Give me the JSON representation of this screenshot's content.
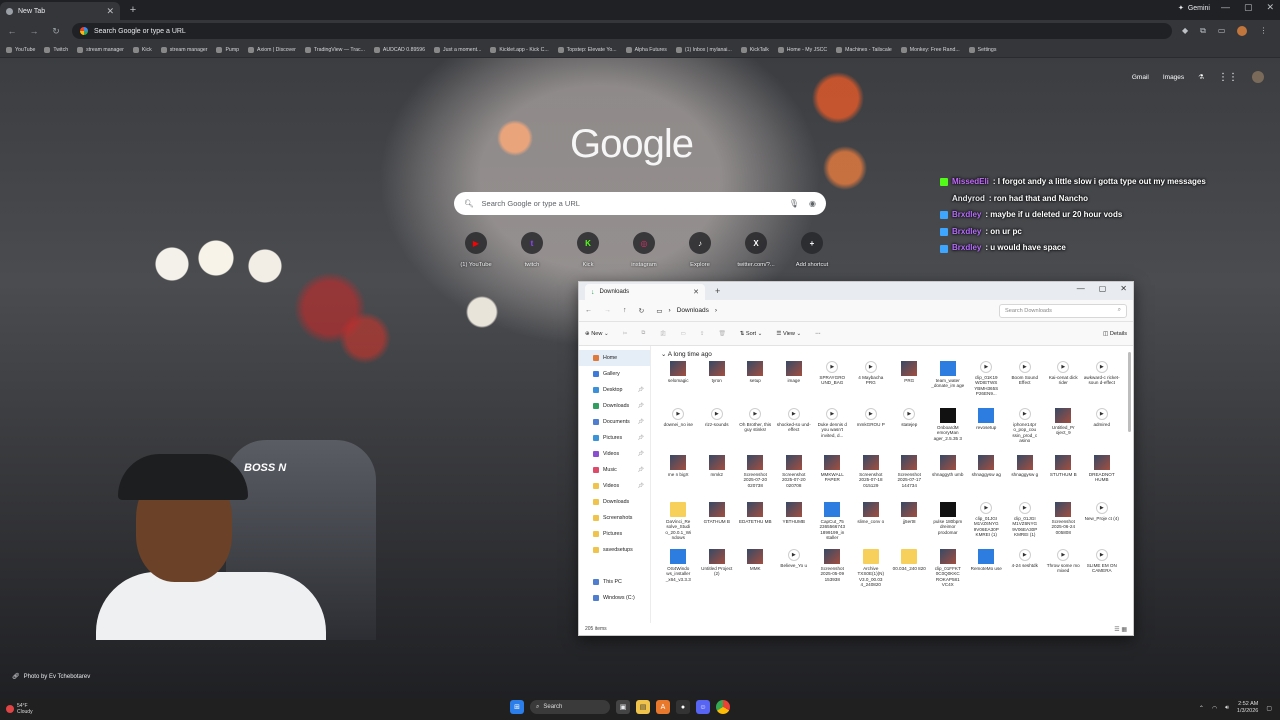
{
  "browser": {
    "tab_title": "New Tab",
    "omnibox_placeholder": "Search Google or type a URL",
    "gemini_label": "Gemini",
    "bookmarks": [
      "YouTube",
      "Twitch",
      "stream manager",
      "Kick",
      "stream manager",
      "Pump",
      "Axiom | Discover",
      "TradingView — Trac...",
      "AUDCAD 0.89596",
      "Just a moment...",
      "Kicklet.app - Kick C...",
      "Topstep: Elevate Yo...",
      "Alpha Futures",
      "(1) Inbox | mylanai...",
      "KickTalk",
      "Home - My JSCC",
      "Machines - Tailscale",
      "Monkey: Free Rand...",
      "Settings"
    ]
  },
  "newtab": {
    "logo": "Google",
    "search_placeholder": "Search Google or type a URL",
    "top_links": {
      "gmail": "Gmail",
      "images": "Images"
    },
    "shortcuts": [
      {
        "label": "(1) YouTube",
        "glyph": "▶",
        "color": "#ff0000"
      },
      {
        "label": "twitch",
        "glyph": "t",
        "color": "#9146ff"
      },
      {
        "label": "Kick",
        "glyph": "K",
        "color": "#53fc18"
      },
      {
        "label": "instagram",
        "glyph": "◎",
        "color": "#e1306c"
      },
      {
        "label": "Explore",
        "glyph": "♪",
        "color": "#ffffff"
      },
      {
        "label": "twitter.com/?...",
        "glyph": "X",
        "color": "#ffffff"
      },
      {
        "label": "Add shortcut",
        "glyph": "+",
        "color": "#ffffff"
      }
    ],
    "photo_credit": "Photo by Ev Tchebotarev"
  },
  "chat": [
    {
      "user": "MissedEli",
      "color": "#c56bff",
      "badge": "g",
      "message": ": I forgot andy a little slow i gotta type out my messages"
    },
    {
      "user": "Andyrod",
      "color": "#e8eaed",
      "badge": "",
      "message": ": ron had that and Nancho"
    },
    {
      "user": "Brxdley",
      "color": "#b76cff",
      "badge": "b",
      "message": ": maybe if u deleted ur 20 hour vods"
    },
    {
      "user": "Brxdley",
      "color": "#b76cff",
      "badge": "b",
      "message": ": on ur pc"
    },
    {
      "user": "Brxdley",
      "color": "#b76cff",
      "badge": "b",
      "message": ": u would have space"
    }
  ],
  "webcam": {
    "chair_text": "BOSS N"
  },
  "explorer": {
    "tab_title": "Downloads",
    "path": "Downloads",
    "search_placeholder": "Search Downloads",
    "commands": {
      "new": "New",
      "sort": "Sort",
      "view": "View",
      "details": "Details"
    },
    "sidebar": [
      {
        "label": "Home",
        "color": "#e07a3a",
        "selected": true,
        "pin": false
      },
      {
        "label": "Gallery",
        "color": "#3c7bd9",
        "selected": false,
        "pin": false
      },
      {
        "label": "Desktop",
        "color": "#3c8fd9",
        "selected": false,
        "pin": true
      },
      {
        "label": "Downloads",
        "color": "#2f9e5f",
        "selected": false,
        "pin": true
      },
      {
        "label": "Documents",
        "color": "#4f7ed0",
        "selected": false,
        "pin": true
      },
      {
        "label": "Pictures",
        "color": "#3b93d8",
        "selected": false,
        "pin": true
      },
      {
        "label": "Videos",
        "color": "#8a4fd0",
        "selected": false,
        "pin": true
      },
      {
        "label": "Music",
        "color": "#e04a6a",
        "selected": false,
        "pin": true
      },
      {
        "label": "Videos",
        "color": "#f0c44c",
        "selected": false,
        "pin": true
      },
      {
        "label": "Downloads",
        "color": "#f0c44c",
        "selected": false,
        "pin": false
      },
      {
        "label": "Screenshots",
        "color": "#f0c44c",
        "selected": false,
        "pin": false
      },
      {
        "label": "Pictures",
        "color": "#f0c44c",
        "selected": false,
        "pin": false
      },
      {
        "label": "savedsetups",
        "color": "#f0c44c",
        "selected": false,
        "pin": false
      },
      {
        "label": "",
        "color": "transparent",
        "selected": false,
        "pin": false
      },
      {
        "label": "This PC",
        "color": "#4f7ed0",
        "selected": false,
        "pin": false
      },
      {
        "label": "Windows (C:)",
        "color": "#4f7ed0",
        "selected": false,
        "pin": false
      }
    ],
    "group_label": "A long time ago",
    "files": [
      {
        "name": "selomagic",
        "kind": "img"
      },
      {
        "name": "tyron",
        "kind": "img"
      },
      {
        "name": "setup",
        "kind": "img"
      },
      {
        "name": "image",
        "kind": "img"
      },
      {
        "name": "SPRAYGRO UND_BAG",
        "kind": "vid"
      },
      {
        "name": "4 Maybacha PRG",
        "kind": "vid"
      },
      {
        "name": "PRG",
        "kind": "img"
      },
      {
        "name": "team_water _donate_im age",
        "kind": "app"
      },
      {
        "name": "clip_01K19 WDIETWS YBMH365S P26EN9...",
        "kind": "vid"
      },
      {
        "name": "Boom Sound Effect",
        "kind": "vid"
      },
      {
        "name": "Kai-cenat dick rider",
        "kind": "vid"
      },
      {
        "name": "awkward-c ricket-soun d-effect",
        "kind": "vid"
      },
      {
        "name": "downei_no ise",
        "kind": "vid"
      },
      {
        "name": "rizz-sounds",
        "kind": "vid"
      },
      {
        "name": "Oh Brother, this guy stinks!",
        "kind": "vid"
      },
      {
        "name": "shocked-so und-effect",
        "kind": "vid"
      },
      {
        "name": "Duke dennis d you wasn't invited, d...",
        "kind": "vid"
      },
      {
        "name": "mmkGROU P",
        "kind": "vid"
      },
      {
        "name": "statejep",
        "kind": "vid"
      },
      {
        "name": "OnboardM emoryMan ager_2.5.35 3",
        "kind": "dark"
      },
      {
        "name": "revosetup",
        "kind": "app"
      },
      {
        "name": "iphone14pr o_pop_cou ssin_prod_c asino",
        "kind": "vid"
      },
      {
        "name": "Untitled_Pr oject_9",
        "kind": "img"
      },
      {
        "name": "admired",
        "kind": "vid"
      },
      {
        "name": "me n bigX",
        "kind": "img"
      },
      {
        "name": "mmk2",
        "kind": "img"
      },
      {
        "name": "Screenshot 2025-07-20 020738",
        "kind": "img"
      },
      {
        "name": "Screenshot 2025-07-20 020708",
        "kind": "img"
      },
      {
        "name": "MMKWALL PAPER",
        "kind": "img"
      },
      {
        "name": "Screenshot 2025-07-18 015129",
        "kind": "img"
      },
      {
        "name": "Screenshot 2025-07-17 144734",
        "kind": "img"
      },
      {
        "name": "shnaggyth umb",
        "kind": "img"
      },
      {
        "name": "shnaggysw ag",
        "kind": "img"
      },
      {
        "name": "shnaggysw g",
        "kind": "img"
      },
      {
        "name": "STUTHUM B",
        "kind": "img"
      },
      {
        "name": "DREADNOT HUMB",
        "kind": "img"
      },
      {
        "name": "DaVinci_Re solve_Studi o_20.0.1_Wi ndows",
        "kind": "folder"
      },
      {
        "name": "GTATHUM B",
        "kind": "img"
      },
      {
        "name": "EDATETHU MB",
        "kind": "img"
      },
      {
        "name": "YBTHUMB",
        "kind": "img"
      },
      {
        "name": "CapCut_75 2365566743 1899199_in staller",
        "kind": "app"
      },
      {
        "name": "slime_conv o",
        "kind": "img"
      },
      {
        "name": "jj5ert8",
        "kind": "img"
      },
      {
        "name": "pulse 180bpm dreimor prodomar",
        "kind": "dark"
      },
      {
        "name": "clip_01JGI M1VZ6NYG 9V06EA30P KMREI (1)",
        "kind": "vid"
      },
      {
        "name": "clip_01JGI M1VZ6NYG 9V06EA30P KMREI (1)",
        "kind": "vid"
      },
      {
        "name": "Screenshot 2025-06-24 005808",
        "kind": "img"
      },
      {
        "name": "New_Proje ct (4)",
        "kind": "vid"
      },
      {
        "name": "OS4Windo ws_installer _x64_v3.3.3",
        "kind": "app"
      },
      {
        "name": "Untitled Project (2)",
        "kind": "img"
      },
      {
        "name": "MMK",
        "kind": "img"
      },
      {
        "name": "Believe_Yo u",
        "kind": "vid"
      },
      {
        "name": "Screenshot 2025-05-09 153938",
        "kind": "img"
      },
      {
        "name": "Archive TXS0E(1)(N) V3.0_00.03 4_240820",
        "kind": "folder"
      },
      {
        "name": "00.034_240 820",
        "kind": "folder"
      },
      {
        "name": "clip_01FFKT 0C0Q0KKC ROKAP581 VC4X",
        "kind": "img"
      },
      {
        "name": "RemoteMo use",
        "kind": "app"
      },
      {
        "name": "4-24 seshtdk",
        "kind": "vid"
      },
      {
        "name": "Throw some mo mixed",
        "kind": "vid"
      },
      {
        "name": "SLIME EM ON CAMERA",
        "kind": "vid"
      }
    ],
    "status": "205 items"
  },
  "taskbar": {
    "weather_temp": "54°F",
    "weather_desc": "Cloudy",
    "search_label": "Search",
    "time": "2:52 AM",
    "date": "1/3/2026"
  }
}
